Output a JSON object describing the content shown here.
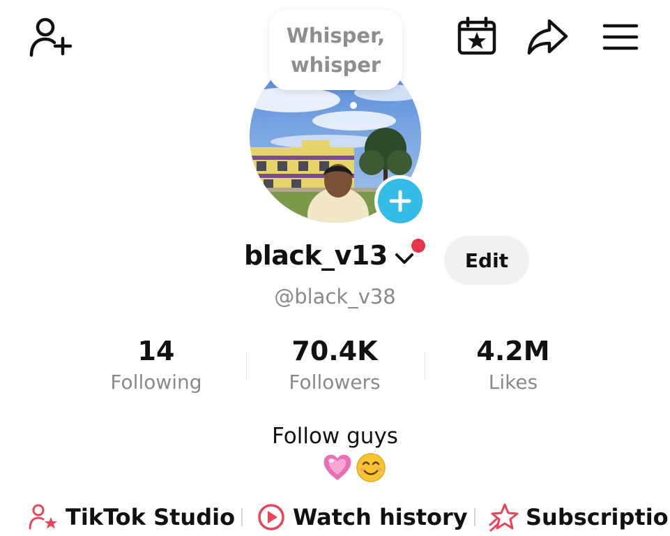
{
  "header": {
    "add_friend_icon": "person-plus-icon",
    "calendar_icon": "calendar-star-icon",
    "share_icon": "share-arrow-icon",
    "menu_icon": "hamburger-menu-icon"
  },
  "whisper": {
    "line1": "Whisper,",
    "line2": "whisper"
  },
  "profile": {
    "username": "black_v13",
    "handle": "@black_v38",
    "edit_label": "Edit",
    "notification_color": "#e4364a",
    "add_badge_color": "#33bde6"
  },
  "stats": [
    {
      "value": "14",
      "label": "Following"
    },
    {
      "value": "70.4K",
      "label": "Followers"
    },
    {
      "value": "4.2M",
      "label": "Likes"
    }
  ],
  "bio": {
    "text": "Follow guys",
    "emojis": [
      "heart-emoji",
      "smile-emoji"
    ]
  },
  "links": [
    {
      "label": "TikTok Studio",
      "icon": "studio-person-star-icon"
    },
    {
      "label": "Watch history",
      "icon": "play-circle-icon"
    },
    {
      "label": "Subscriptior",
      "icon": "star-ribbon-icon"
    }
  ],
  "accent_color": "#e8445a"
}
